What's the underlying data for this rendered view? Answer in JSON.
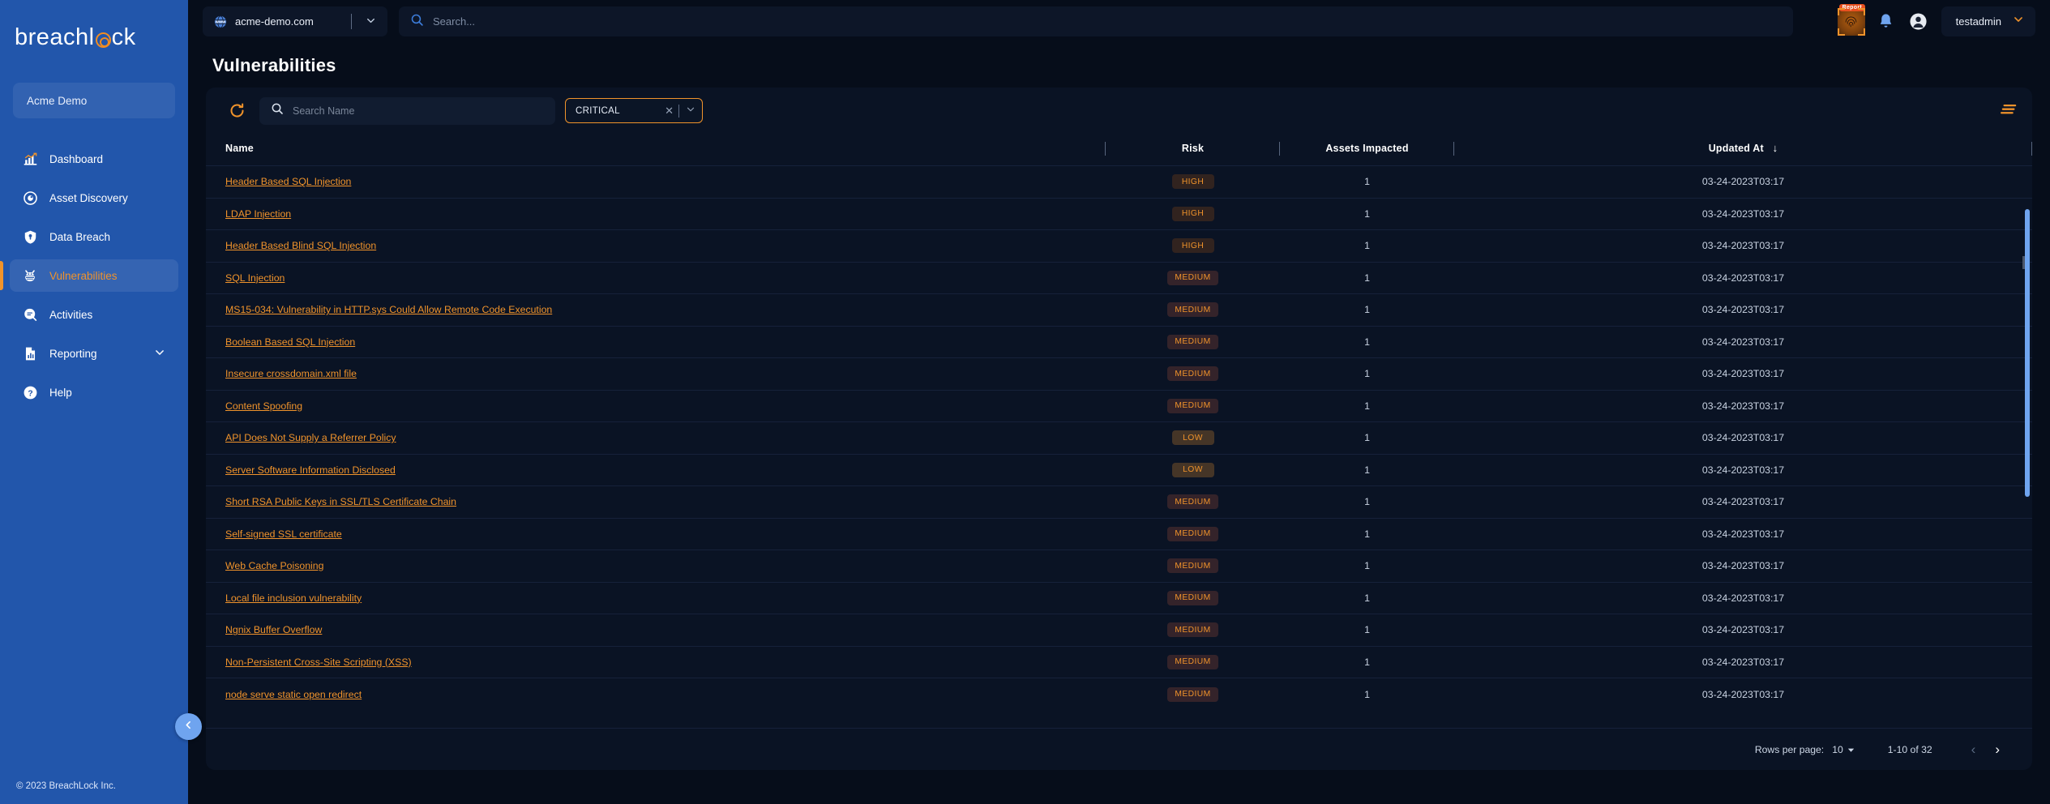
{
  "brand": {
    "logo_text_left": "breachl",
    "logo_text_right": "ck"
  },
  "sidebar": {
    "org": "Acme Demo",
    "items": [
      {
        "label": "Dashboard",
        "icon": "chart-icon",
        "active": false
      },
      {
        "label": "Asset Discovery",
        "icon": "target-icon",
        "active": false
      },
      {
        "label": "Data Breach",
        "icon": "shield-lock-icon",
        "active": false
      },
      {
        "label": "Vulnerabilities",
        "icon": "bug-icon",
        "active": true
      },
      {
        "label": "Activities",
        "icon": "activity-icon",
        "active": false
      },
      {
        "label": "Reporting",
        "icon": "report-icon",
        "active": false,
        "expandable": true
      },
      {
        "label": "Help",
        "icon": "help-icon",
        "active": false
      }
    ],
    "copyright": "© 2023 BreachLock Inc."
  },
  "topbar": {
    "domain": "acme-demo.com",
    "search_placeholder": "Search...",
    "search_value": "",
    "fingerprint_badge": "Report",
    "user": "testadmin"
  },
  "page": {
    "title": "Vulnerabilities"
  },
  "toolbar": {
    "search_placeholder": "Search Name",
    "search_value": "",
    "filter_value": "CRITICAL"
  },
  "table": {
    "columns": [
      "Name",
      "Risk",
      "Assets Impacted",
      "Updated At"
    ],
    "sort_column": "Updated At",
    "sort_direction": "desc",
    "rows": [
      {
        "name": "Header Based SQL Injection",
        "risk": "HIGH",
        "assets": "1",
        "updated": "03-24-2023T03:17"
      },
      {
        "name": "LDAP Injection",
        "risk": "HIGH",
        "assets": "1",
        "updated": "03-24-2023T03:17"
      },
      {
        "name": "Header Based Blind SQL Injection",
        "risk": "HIGH",
        "assets": "1",
        "updated": "03-24-2023T03:17"
      },
      {
        "name": "SQL Injection",
        "risk": "MEDIUM",
        "assets": "1",
        "updated": "03-24-2023T03:17"
      },
      {
        "name": "MS15-034: Vulnerability in HTTP.sys Could Allow Remote Code Execution",
        "risk": "MEDIUM",
        "assets": "1",
        "updated": "03-24-2023T03:17"
      },
      {
        "name": "Boolean Based SQL Injection",
        "risk": "MEDIUM",
        "assets": "1",
        "updated": "03-24-2023T03:17"
      },
      {
        "name": "Insecure crossdomain.xml file",
        "risk": "MEDIUM",
        "assets": "1",
        "updated": "03-24-2023T03:17"
      },
      {
        "name": "Content Spoofing",
        "risk": "MEDIUM",
        "assets": "1",
        "updated": "03-24-2023T03:17"
      },
      {
        "name": "API Does Not Supply a Referrer Policy",
        "risk": "LOW",
        "assets": "1",
        "updated": "03-24-2023T03:17"
      },
      {
        "name": "Server Software Information Disclosed",
        "risk": "LOW",
        "assets": "1",
        "updated": "03-24-2023T03:17"
      },
      {
        "name": "Short RSA Public Keys in SSL/TLS Certificate Chain",
        "risk": "MEDIUM",
        "assets": "1",
        "updated": "03-24-2023T03:17"
      },
      {
        "name": "Self-signed SSL certificate",
        "risk": "MEDIUM",
        "assets": "1",
        "updated": "03-24-2023T03:17"
      },
      {
        "name": "Web Cache Poisoning",
        "risk": "MEDIUM",
        "assets": "1",
        "updated": "03-24-2023T03:17"
      },
      {
        "name": "Local file inclusion vulnerability",
        "risk": "MEDIUM",
        "assets": "1",
        "updated": "03-24-2023T03:17"
      },
      {
        "name": "Ngnix Buffer Overflow",
        "risk": "MEDIUM",
        "assets": "1",
        "updated": "03-24-2023T03:17"
      },
      {
        "name": "Non-Persistent Cross-Site Scripting (XSS)",
        "risk": "MEDIUM",
        "assets": "1",
        "updated": "03-24-2023T03:17"
      },
      {
        "name": "node serve static open redirect",
        "risk": "MEDIUM",
        "assets": "1",
        "updated": "03-24-2023T03:17"
      }
    ]
  },
  "pagination": {
    "rows_label": "Rows per page:",
    "rows_value": "10",
    "range": "1-10 of 32",
    "prev": "‹",
    "next": "›"
  },
  "colors": {
    "accent_orange": "#f0932b",
    "sidebar_blue": "#2256ab",
    "page_bg": "#060d1a",
    "card_bg": "#0a1324",
    "scroll_blue": "#6fa4ef"
  }
}
